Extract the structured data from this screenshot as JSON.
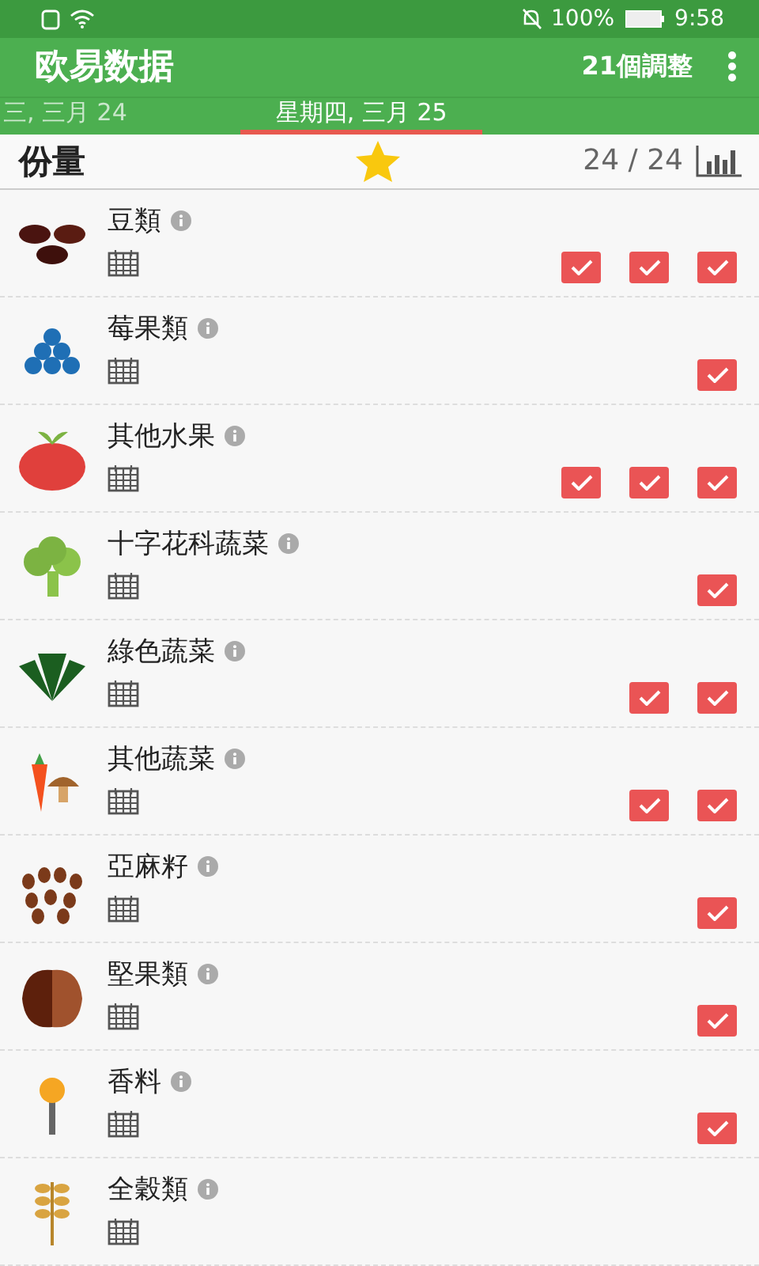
{
  "status_bar": {
    "battery": "100%",
    "time": "9:58"
  },
  "app_bar": {
    "title": "欧易数据",
    "action": "21個調整"
  },
  "tabs": [
    {
      "label": "三, 三月 24",
      "selected": false
    },
    {
      "label": "星期四, 三月 25",
      "selected": true
    }
  ],
  "header": {
    "title": "份量",
    "count": "24 / 24"
  },
  "foods": [
    {
      "name": "豆類",
      "kind": "beans",
      "servings": [
        {
          "checked": true
        },
        {
          "checked": true
        },
        {
          "checked": true
        }
      ]
    },
    {
      "name": "莓果類",
      "kind": "berries",
      "servings": [
        {
          "checked": true
        }
      ]
    },
    {
      "name": "其他水果",
      "kind": "fruit",
      "servings": [
        {
          "checked": true
        },
        {
          "checked": true
        },
        {
          "checked": true
        }
      ]
    },
    {
      "name": "十字花科蔬菜",
      "kind": "broccoli",
      "servings": [
        {
          "checked": true
        }
      ]
    },
    {
      "name": "綠色蔬菜",
      "kind": "greens",
      "servings": [
        {
          "checked": true
        },
        {
          "checked": true
        }
      ]
    },
    {
      "name": "其他蔬菜",
      "kind": "veggies",
      "servings": [
        {
          "checked": true
        },
        {
          "checked": true
        }
      ]
    },
    {
      "name": "亞麻籽",
      "kind": "seeds",
      "servings": [
        {
          "checked": true
        }
      ]
    },
    {
      "name": "堅果類",
      "kind": "nuts",
      "servings": [
        {
          "checked": true
        }
      ]
    },
    {
      "name": "香料",
      "kind": "spice",
      "servings": [
        {
          "checked": true
        }
      ]
    },
    {
      "name": "全穀類",
      "kind": "grains"
    }
  ]
}
